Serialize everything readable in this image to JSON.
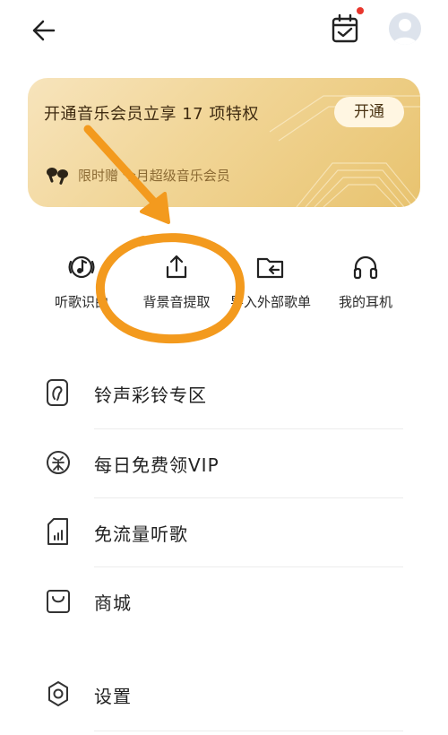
{
  "vip": {
    "title": "开通音乐会员立享 17 项特权",
    "button": "开通",
    "subtitle": "限时赠 个月超级音乐会员"
  },
  "shortcuts": [
    {
      "label": "听歌识曲",
      "icon": "music-recognize-icon"
    },
    {
      "label": "背景音提取",
      "icon": "upload-icon"
    },
    {
      "label": "导入外部歌单",
      "icon": "folder-import-icon"
    },
    {
      "label": "我的耳机",
      "icon": "headphones-icon"
    }
  ],
  "menu": [
    {
      "label": "铃声彩铃专区",
      "icon": "ringtone-icon"
    },
    {
      "label": "每日免费领VIP",
      "icon": "award-icon"
    },
    {
      "label": "免流量听歌",
      "icon": "sim-card-icon"
    },
    {
      "label": "商城",
      "icon": "shopping-bag-icon"
    },
    {
      "label": "设置",
      "icon": "settings-icon"
    }
  ],
  "colors": {
    "annotation": "#f39a1e",
    "badge": "#e8362d",
    "vip_gold": "#f1d596"
  }
}
